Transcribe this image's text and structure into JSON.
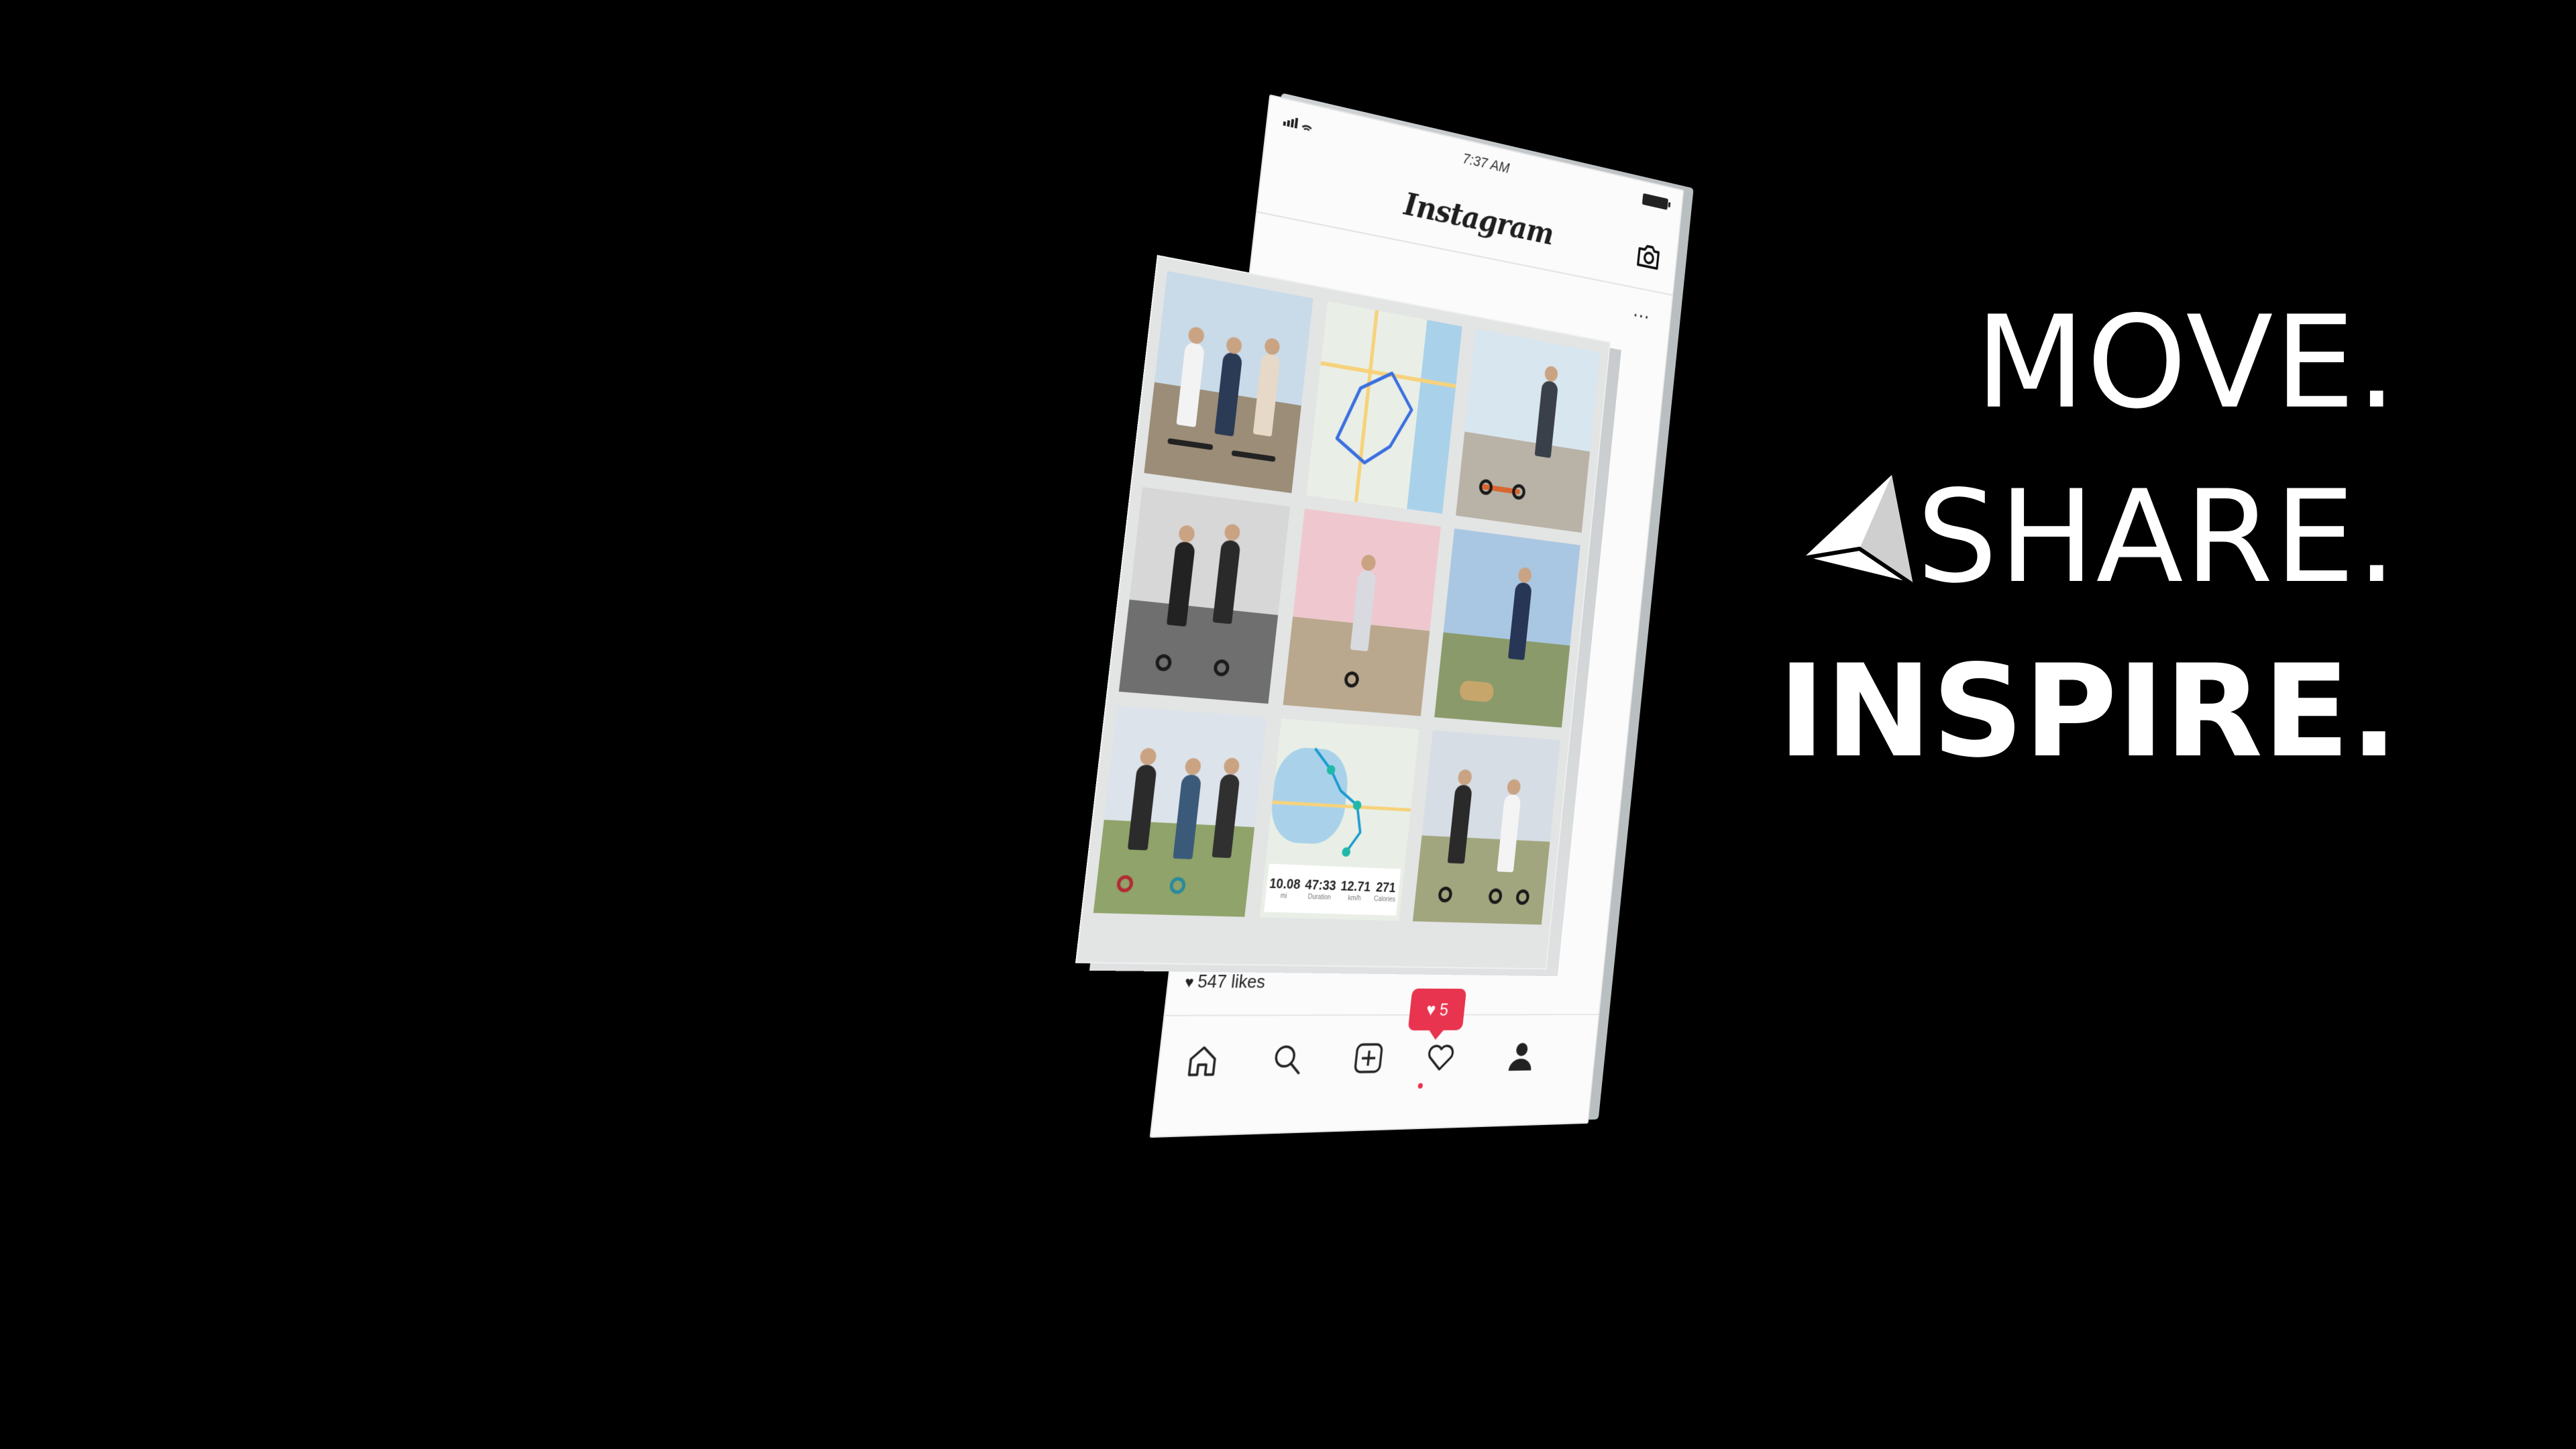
{
  "phone": {
    "status_time": "7:37 AM",
    "app_title": "Instagram",
    "more_label": "···",
    "likes_text": "547 likes",
    "notification_count": "5",
    "icons": {
      "signal": "signal-icon",
      "wifi": "wifi-icon",
      "battery": "battery-icon",
      "camera": "camera-icon",
      "heart": "heart-icon",
      "comment": "comment-icon",
      "share": "send-icon",
      "home": "home-icon",
      "search": "search-icon",
      "add": "add-post-icon",
      "activity": "heart-icon",
      "profile": "profile-icon"
    }
  },
  "grid": {
    "tiles": [
      {
        "type": "photo",
        "subject": "group-scooters-city"
      },
      {
        "type": "map",
        "subject": "route-map"
      },
      {
        "type": "photo",
        "subject": "rider-beach"
      },
      {
        "type": "photo",
        "subject": "two-riders-street"
      },
      {
        "type": "photo",
        "subject": "rider-cherry-blossoms"
      },
      {
        "type": "photo",
        "subject": "rider-with-dog"
      },
      {
        "type": "photo",
        "subject": "three-riders-grass"
      },
      {
        "type": "map",
        "subject": "route-map-stats"
      },
      {
        "type": "photo",
        "subject": "two-riders-park"
      }
    ],
    "stats": [
      {
        "value": "10.08",
        "label": "mi"
      },
      {
        "value": "47:33",
        "label": "Duration"
      },
      {
        "value": "12.71",
        "label": "km/h"
      },
      {
        "value": "271",
        "label": "Calories"
      }
    ]
  },
  "slogan": {
    "line1": "MOVE.",
    "line2": "SHARE.",
    "line3": "INSPIRE."
  },
  "colors": {
    "background": "#000000",
    "accent": "#e8344e",
    "text": "#ffffff"
  }
}
